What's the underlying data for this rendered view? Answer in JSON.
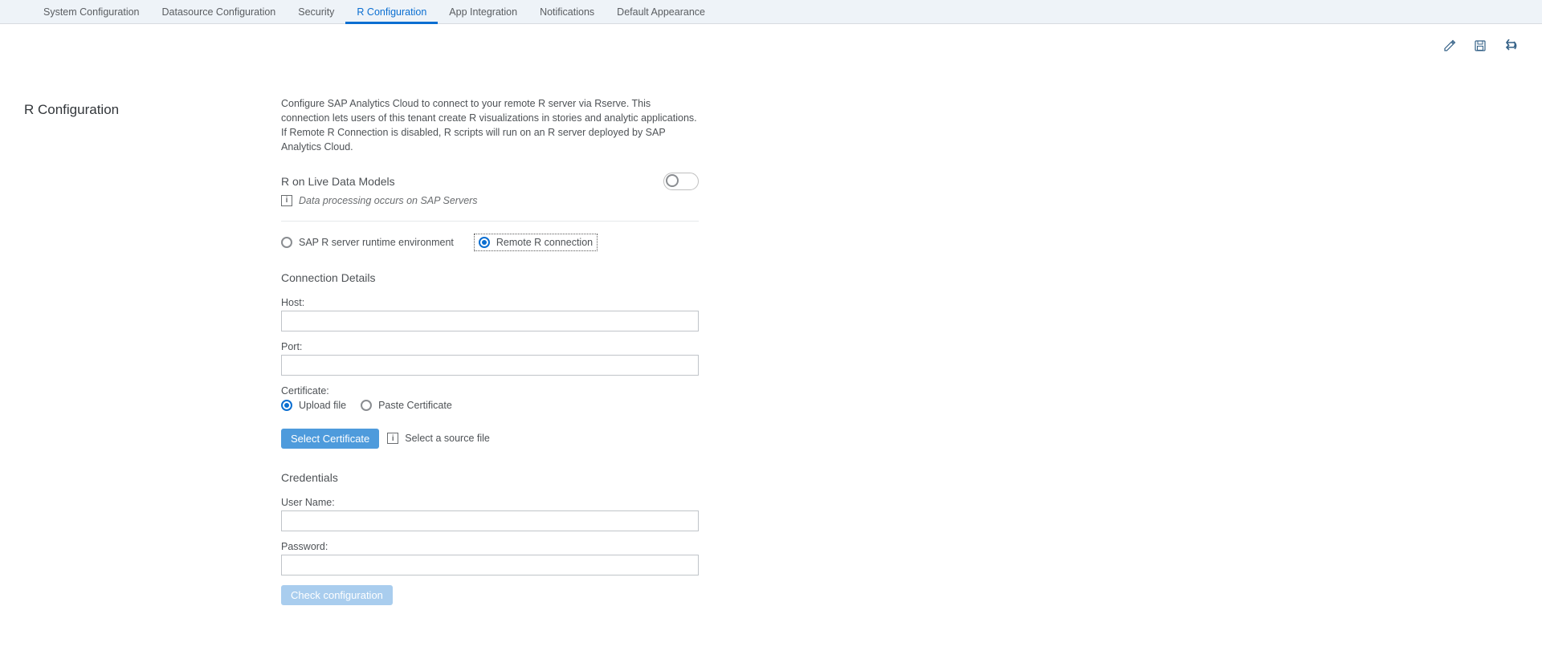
{
  "tabs": {
    "items": [
      "System Configuration",
      "Datasource Configuration",
      "Security",
      "R Configuration",
      "App Integration",
      "Notifications",
      "Default Appearance"
    ],
    "active_index": 3
  },
  "toolbar": {
    "edit_icon": "edit-icon",
    "save_icon": "save-icon",
    "undo_icon": "undo-icon"
  },
  "page_title": "R Configuration",
  "description": "Configure SAP Analytics Cloud to connect to your remote R server via Rserve. This connection lets users of this tenant create R visualizations in stories and analytic applications. If Remote R Connection is disabled, R scripts will run on an R server deployed by SAP Analytics Cloud.",
  "live_data": {
    "label": "R on Live Data Models",
    "note": "Data processing occurs on SAP Servers",
    "toggle_on": false
  },
  "runtime_radio": {
    "sap_label": "SAP R server runtime environment",
    "remote_label": "Remote R connection",
    "selected": "remote"
  },
  "connection": {
    "heading": "Connection Details",
    "host_label": "Host:",
    "host_value": "",
    "port_label": "Port:",
    "port_value": "",
    "certificate_label": "Certificate:",
    "upload_label": "Upload file",
    "paste_label": "Paste Certificate",
    "cert_mode": "upload",
    "select_cert_button": "Select Certificate",
    "select_source_text": "Select a source file"
  },
  "credentials": {
    "heading": "Credentials",
    "user_label": "User Name:",
    "user_value": "",
    "password_label": "Password:",
    "password_value": "",
    "check_button": "Check configuration"
  }
}
